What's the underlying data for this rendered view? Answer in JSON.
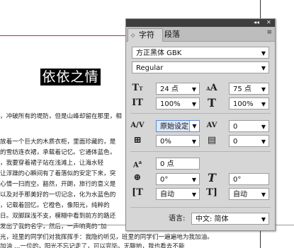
{
  "document": {
    "title": "依依之情",
    "lines": [
      "，冲破所有的堤防，但是山峰却留在那里，相",
      "放着一个巨大的木质衣柜，里面珍藏的，是",
      "的雪纺连衣裙，承载着记忆。它通体蓝色，",
      "，我要穿着裙子站在浅滩上，让海水轻",
      "让浮躁的心瞬间有了着落似的安定下来，突",
      "心情一扫而空。豁然，开朗，旅行的意义是",
      "以及对手那美好的一切记念，化为水蓝色的",
      "，记载着回忆。它橙色，像阳光，纯粹的",
      "日。双脚踩浅不支，模糊中看到前方的路还",
      "发出了我的名字，然后，一声响亮的“加",
      "光，班里的同学们对我挥挥手：我隐约听见，班里的同学们一遍遍地为我加油。",
      "加油 …一位的，阳光不忘记走了，可以完毕。无聊地，我也看去不能"
    ]
  },
  "panel": {
    "top_controls": {
      "collapse": "◂◂",
      "close": "✕"
    },
    "tabs": [
      {
        "label": "字符",
        "arrows": "◇"
      },
      {
        "label": "段落"
      }
    ],
    "menu_icon": "≡",
    "font_family": "方正黑体 GBK",
    "font_style": "Regular",
    "font_size": "24 点",
    "leading": "75 点",
    "vertical_scale": "100%",
    "horizontal_scale": "100%",
    "kerning": "原始设定",
    "tracking": "0",
    "tsume": "0%",
    "aki": "0",
    "baseline_shift": "0 点",
    "character_rotation": "0°",
    "skew": "0°",
    "aki_before": "自动",
    "aki_after": "自动",
    "language_label": "语言:",
    "language": "中文: 简体",
    "icons": {
      "font_size": "font-size-icon",
      "leading": "leading-icon",
      "vertical_scale": "vertical-scale-icon",
      "horizontal_scale": "horizontal-scale-icon",
      "kerning": "kerning-icon",
      "tracking": "tracking-icon",
      "tsume": "tsume-icon",
      "aki": "aki-icon",
      "baseline_shift": "baseline-shift-icon",
      "rotation": "rotation-icon",
      "skew": "skew-icon",
      "aki_before": "aki-before-icon",
      "aki_after": "aki-after-icon"
    },
    "colors": {
      "accent": "#5a8bd6",
      "panel_bg": "#d6d6d6",
      "titlebar": "#3e3e3e"
    }
  }
}
